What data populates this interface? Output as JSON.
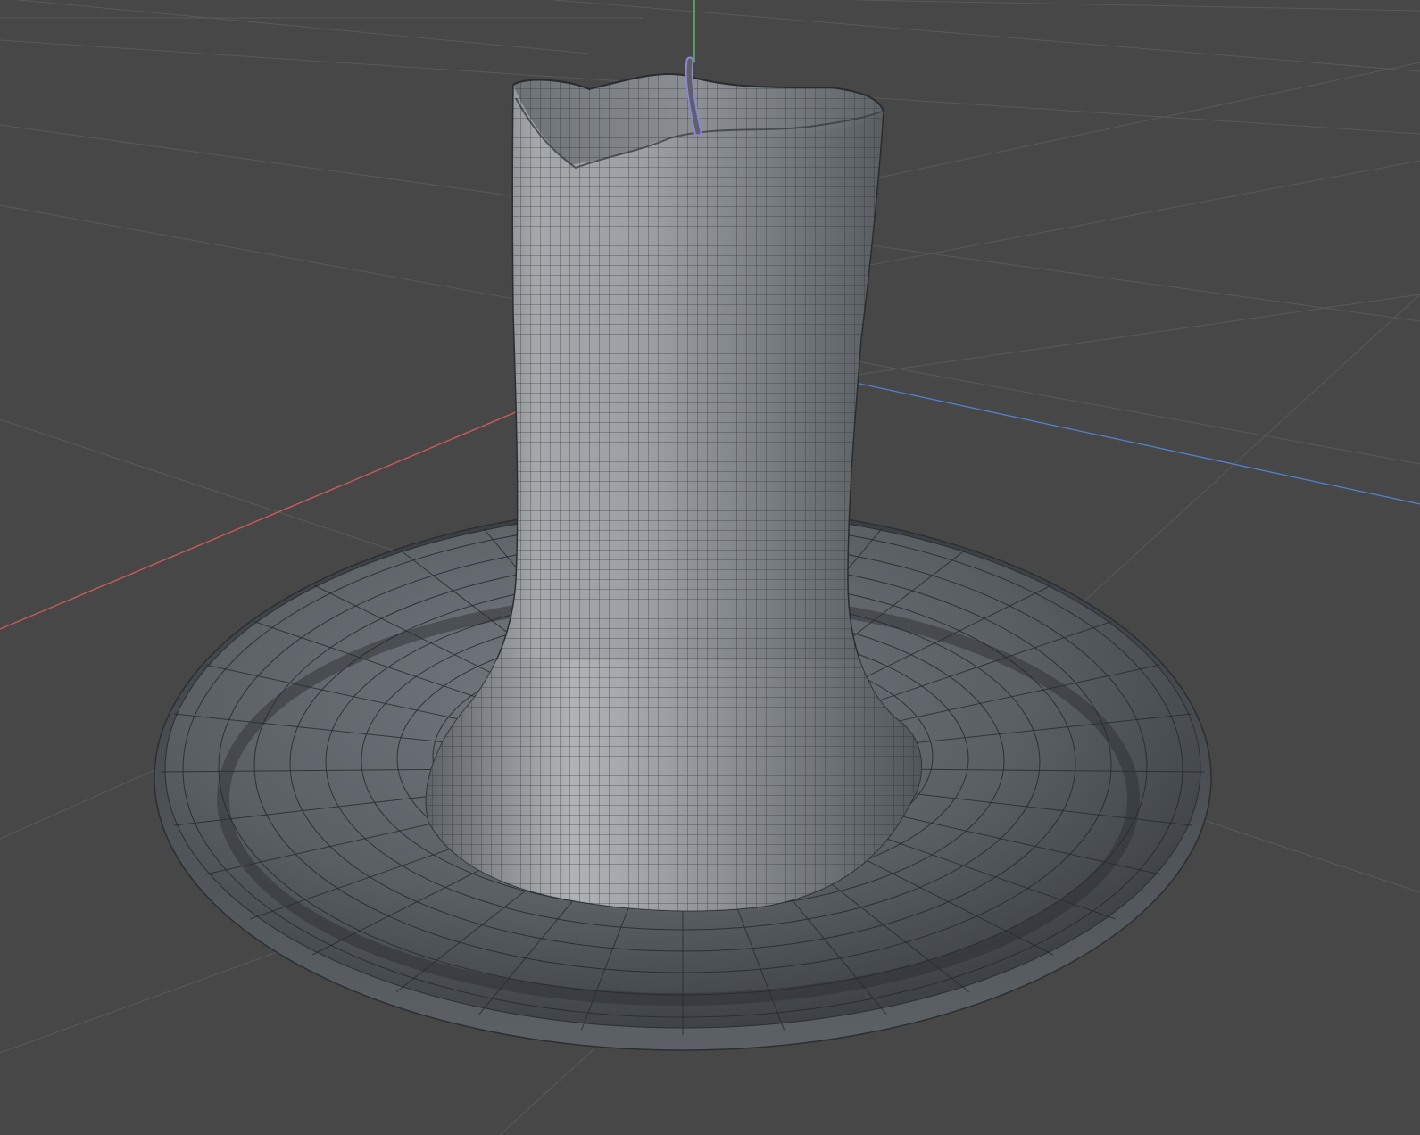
{
  "viewport": {
    "view": "3d-perspective",
    "background_color": "#474747",
    "grid_color": "#5f5f5f",
    "grid_visible": true,
    "wireframe_on_shaded": true
  },
  "axes": {
    "x_axis_color": "#c85a5a",
    "y_axis_color": "#5fbf6f",
    "z_axis_color": "#4f7fc8"
  },
  "scene_objects": [
    {
      "type": "candle",
      "mesh_color": "#8f9397"
    },
    {
      "type": "candle-holder-dish",
      "mesh_color": "#6f7479"
    },
    {
      "type": "wick",
      "selected": true,
      "highlight_color": "#8a86d8"
    }
  ]
}
